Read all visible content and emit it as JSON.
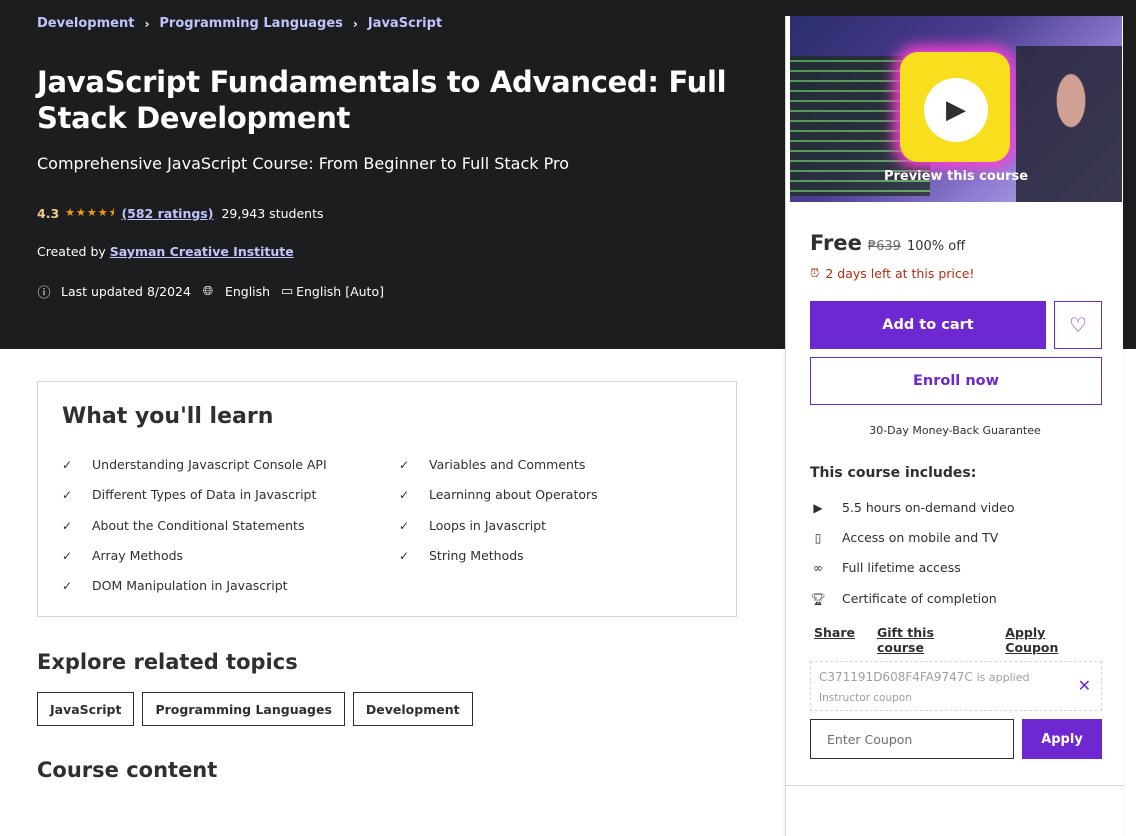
{
  "breadcrumb": [
    "Development",
    "Programming Languages",
    "JavaScript"
  ],
  "course": {
    "title": "JavaScript Fundamentals to Advanced: Full Stack Development",
    "subtitle": "Comprehensive JavaScript Course: From Beginner to Full Stack Pro",
    "rating": "4.3",
    "stars_value": 4.3,
    "ratings_count": "(582 ratings)",
    "students": "29,943 students",
    "created_by_label": "Created by",
    "instructor": "Sayman Creative Institute",
    "last_updated": "Last updated 8/2024",
    "language": "English",
    "captions": "English [Auto]"
  },
  "learn": {
    "title": "What you'll learn",
    "items": [
      "Understanding Javascript Console API",
      "Variables and Comments",
      "Different Types of Data in Javascript",
      "Learninng about Operators",
      "About the Conditional Statements",
      "Loops in Javascript",
      "Array Methods",
      "String Methods",
      "DOM Manipulation in Javascript"
    ]
  },
  "explore": {
    "title": "Explore related topics",
    "topics": [
      "JavaScript",
      "Programming Languages",
      "Development"
    ]
  },
  "course_content_title": "Course content",
  "sidebar": {
    "preview_label": "Preview this course",
    "price": "Free",
    "original_price": "₱639",
    "discount": "100% off",
    "deadline": "2 days left at this price!",
    "add_to_cart": "Add to cart",
    "enroll_now": "Enroll now",
    "guarantee": "30-Day Money-Back Guarantee",
    "includes_title": "This course includes:",
    "includes": [
      {
        "icon": "video-icon",
        "text": "5.5 hours on-demand video"
      },
      {
        "icon": "mobile-icon",
        "text": "Access on mobile and TV"
      },
      {
        "icon": "infinity-icon",
        "text": "Full lifetime access"
      },
      {
        "icon": "trophy-icon",
        "text": "Certificate of completion"
      }
    ],
    "links": [
      "Share",
      "Gift this course",
      "Apply Coupon"
    ],
    "coupon_code": "C371191D608F4FA9747C",
    "coupon_applied_suffix": "is applied",
    "coupon_type": "Instructor coupon",
    "coupon_placeholder": "Enter Coupon",
    "apply_label": "Apply"
  },
  "colors": {
    "hero_bg": "#1c1d1f",
    "accent": "#6d28d2",
    "link_light": "#c0c4fc",
    "star": "#f69c08",
    "deadline": "#b32d0f"
  }
}
